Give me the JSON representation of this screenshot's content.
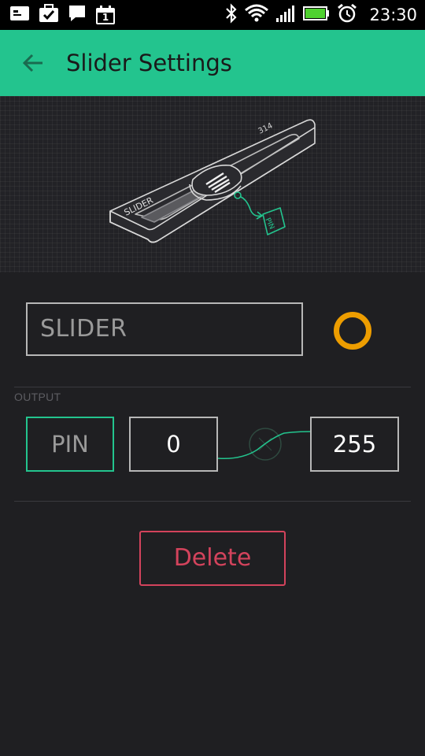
{
  "status_bar": {
    "time": "23:30",
    "notification_icons": [
      "mail-icon",
      "briefcase-check-icon",
      "message-icon",
      "calendar-icon"
    ],
    "calendar_day": "1",
    "system_icons": [
      "bluetooth-icon",
      "wifi-icon",
      "signal-icon",
      "battery-icon",
      "alarm-icon"
    ]
  },
  "app_bar": {
    "title": "Slider Settings",
    "background_color": "#23c48e"
  },
  "preview": {
    "widget_label": "SLIDER",
    "widget_value": "314",
    "pin_tag": "PIN"
  },
  "name_field": {
    "value": "SLIDER"
  },
  "color_picker": {
    "color": "#ed9d00"
  },
  "output": {
    "section_label": "OUTPUT",
    "pin_label": "PIN",
    "min_value": "0",
    "max_value": "255"
  },
  "delete_button": {
    "label": "Delete",
    "color": "#d3435c"
  }
}
